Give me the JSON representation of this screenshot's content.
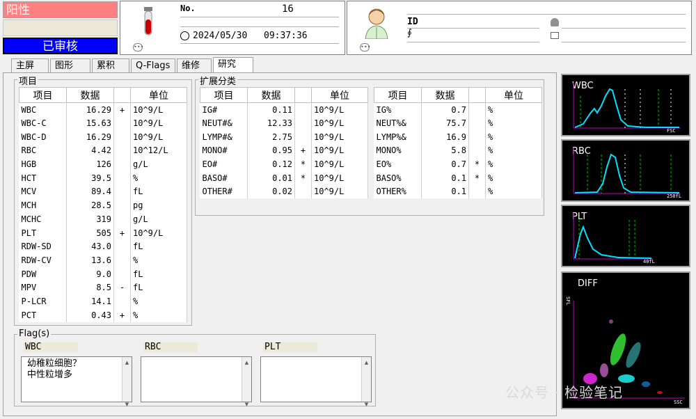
{
  "status": {
    "result": "阳性",
    "review": "已审核"
  },
  "sample": {
    "no_label": "No.",
    "no_value": "16",
    "date": "2024/05/30",
    "time": "09:37:36"
  },
  "patient": {
    "id_label": "ID"
  },
  "tabs": [
    "主屏",
    "图形",
    "累积",
    "Q-Flags",
    "维修",
    "研究"
  ],
  "items_group": {
    "title": "项目",
    "headers": [
      "项目",
      "数据",
      "",
      "单位"
    ],
    "rows": [
      [
        "WBC",
        "16.29",
        "+",
        "10^9/L"
      ],
      [
        "WBC-C",
        "15.63",
        "",
        "10^9/L"
      ],
      [
        "WBC-D",
        "16.29",
        "",
        "10^9/L"
      ],
      [
        "RBC",
        "4.42",
        "",
        "10^12/L"
      ],
      [
        "HGB",
        "126",
        "",
        "g/L"
      ],
      [
        "HCT",
        "39.5",
        "",
        "%"
      ],
      [
        "MCV",
        "89.4",
        "",
        "fL"
      ],
      [
        "MCH",
        "28.5",
        "",
        "pg"
      ],
      [
        "MCHC",
        "319",
        "",
        "g/L"
      ],
      [
        "PLT",
        "505",
        "+",
        "10^9/L"
      ],
      [
        "RDW-SD",
        "43.0",
        "",
        "fL"
      ],
      [
        "RDW-CV",
        "13.6",
        "",
        "%"
      ],
      [
        "PDW",
        "9.0",
        "",
        "fL"
      ],
      [
        "MPV",
        "8.5",
        "-",
        "fL"
      ],
      [
        "P-LCR",
        "14.1",
        "",
        "%"
      ],
      [
        "PCT",
        "0.43",
        "+",
        "%"
      ]
    ]
  },
  "ext_group": {
    "title": "扩展分类",
    "headers": [
      "项目",
      "数据",
      "",
      "单位"
    ],
    "left_rows": [
      [
        "IG#",
        "0.11",
        "",
        "10^9/L"
      ],
      [
        "NEUT#&",
        "12.33",
        "",
        "10^9/L"
      ],
      [
        "LYMP#&",
        "2.75",
        "",
        "10^9/L"
      ],
      [
        "MONO#",
        "0.95",
        "+",
        "10^9/L"
      ],
      [
        "EO#",
        "0.12",
        "*",
        "10^9/L"
      ],
      [
        "BASO#",
        "0.01",
        "*",
        "10^9/L"
      ],
      [
        "OTHER#",
        "0.02",
        "",
        "10^9/L"
      ]
    ],
    "right_rows": [
      [
        "IG%",
        "0.7",
        "",
        "%"
      ],
      [
        "NEUT%&",
        "75.7",
        "",
        "%"
      ],
      [
        "LYMP%&",
        "16.9",
        "",
        "%"
      ],
      [
        "MONO%",
        "5.8",
        "",
        "%"
      ],
      [
        "EO%",
        "0.7",
        "*",
        "%"
      ],
      [
        "BASO%",
        "0.1",
        "*",
        "%"
      ],
      [
        "OTHER%",
        "0.1",
        "",
        "%"
      ]
    ]
  },
  "flags": {
    "title": "Flag(s)",
    "wbc_label": "WBC",
    "rbc_label": "RBC",
    "plt_label": "PLT",
    "wbc_lines": [
      "幼稚粒细胞？",
      "中性粒增多"
    ]
  },
  "scatter": {
    "wbc": {
      "label": "WBC",
      "axis": "FSC"
    },
    "rbc": {
      "label": "RBC",
      "axis": "250fL"
    },
    "plt": {
      "label": "PLT",
      "axis": "40fL"
    },
    "diff": {
      "label": "DIFF",
      "xaxis": "SSC",
      "yaxis": "SFL"
    }
  },
  "watermark": "公众号 · 检验笔记",
  "colors": {
    "positive": "#ff8080",
    "review": "#0000ff",
    "curve": "#00e0ff",
    "axis": "#c000c0",
    "gate": "#00c000"
  }
}
